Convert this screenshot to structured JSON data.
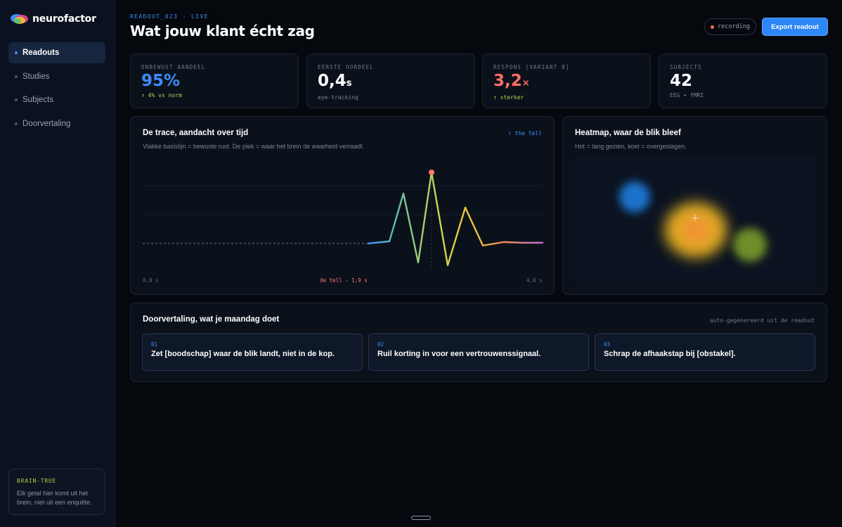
{
  "brand": {
    "name": "neurofactor"
  },
  "sidebar": {
    "items": [
      {
        "label": "Readouts",
        "active": true
      },
      {
        "label": "Studies",
        "active": false
      },
      {
        "label": "Subjects",
        "active": false
      },
      {
        "label": "Doorvertaling",
        "active": false
      }
    ],
    "card": {
      "tag": "BRAIN-TRUE",
      "text": "Elk getal hier komt uit het brein, niet uit een enquête."
    }
  },
  "header": {
    "eyebrow": "READOUT_023 · LIVE",
    "title": "Wat jouw klant écht zag",
    "recording_label": "recording",
    "export_label": "Export readout"
  },
  "stats": [
    {
      "label": "ONBEWUST AANDEEL",
      "value": "95%",
      "unit": "",
      "sub": "↑ 4% vs norm"
    },
    {
      "label": "EERSTE OORDEEL",
      "value": "0,4",
      "unit": "s",
      "sub": "eye-tracking"
    },
    {
      "label": "RESPONS [VARIANT B]",
      "value": "3,2",
      "unit": "×",
      "sub": "↑ sterker"
    },
    {
      "label": "SUBJECTS",
      "value": "42",
      "unit": "",
      "sub": "EEG + fMRI"
    }
  ],
  "trace": {
    "title": "De trace, aandacht over tijd",
    "subtitle": "Vlakke basislijn = bewuste rust. De piek = waar het brein de waarheid verraadt.",
    "tell_link": "↑ the tell",
    "x_start_label": "0,0 s",
    "x_end_label": "4,0 s",
    "tell_label": "de tell · 1,9 s"
  },
  "heatmap": {
    "title": "Heatmap, waar de blik bleef",
    "subtitle": "Hot = lang gezien, koel = overgeslagen."
  },
  "translation": {
    "title": "Doorvertaling, wat je maandag doet",
    "note": "auto-gegenereerd uit de readout",
    "items": [
      {
        "num": "01",
        "text": "Zet [boodschap] waar de blik landt, niet in de kop."
      },
      {
        "num": "02",
        "text": "Ruil korting in voor een vertrouwenssignaal."
      },
      {
        "num": "03",
        "text": "Schrap de afhaakstap bij [obstakel]."
      }
    ]
  },
  "colors": {
    "accent": "#2f86f6",
    "alert": "#ff6f66",
    "positive": "#b8d04a",
    "background": "#05080d"
  }
}
